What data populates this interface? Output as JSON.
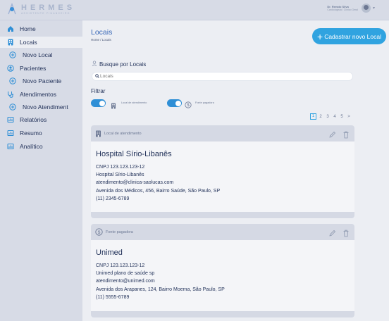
{
  "brand": {
    "title": "HERMES",
    "subtitle": "ASSISTENTE FINANCEIRO"
  },
  "user": {
    "name": "Dr. Renato Silva",
    "role": "Cardiologista / Clínico Geral"
  },
  "sidebar": {
    "items": [
      {
        "label": "Home",
        "icon": "home-icon",
        "active": false
      },
      {
        "label": "Locais",
        "icon": "building-icon",
        "active": true
      },
      {
        "label": "Novo Local",
        "icon": "plus-circle-icon",
        "active": false
      },
      {
        "label": "Pacientes",
        "icon": "user-circle-icon",
        "active": false
      },
      {
        "label": "Novo Paciente",
        "icon": "plus-circle-icon",
        "active": false
      },
      {
        "label": "Atendimentos",
        "icon": "stethoscope-icon",
        "active": false
      },
      {
        "label": "Novo Atendimento",
        "icon": "plus-circle-icon",
        "active": false
      },
      {
        "label": "Relatórios",
        "icon": "report-icon",
        "active": false
      },
      {
        "label": "Resumo",
        "icon": "report-icon",
        "active": false
      },
      {
        "label": "Analítico",
        "icon": "report-icon",
        "active": false
      }
    ]
  },
  "page": {
    "title": "Locais",
    "breadcrumb": "Home / Locais",
    "add_button": "Cadastrar novo Local"
  },
  "search": {
    "title": "Busque por Locais",
    "placeholder": "Locais"
  },
  "filter": {
    "label": "Filtrar",
    "options": [
      {
        "label": "Local de atendimento",
        "checked": true,
        "icon": "building-icon"
      },
      {
        "label": "Fonte pagadora",
        "checked": true,
        "icon": "dollar-circle-icon"
      }
    ]
  },
  "pagination": {
    "current": "1",
    "pages": [
      "1",
      "2",
      "3",
      "4",
      "5"
    ],
    "next": ">"
  },
  "cards": [
    {
      "type": "Local de atendimento",
      "type_icon": "building-icon",
      "name": "Hospital Sírio-Libanês",
      "lines": [
        "CNPJ 123.123.123-12",
        "Hospital Sírio-Libanês",
        "atendimento@clinica-saolucas.com",
        "Avenida dos Médicos, 456, Bairro Saúde, São Paulo, SP",
        "(11) 2345-6789"
      ]
    },
    {
      "type": "Fonte pagadora",
      "type_icon": "dollar-circle-icon",
      "name": "Unimed",
      "lines": [
        "CNPJ 123.123.123-12",
        "Unimed plano de saúde sp",
        "atendimento@unimed.com",
        "Avenida dos Arapanes, 124, Bairro Moema, São Paulo, SP",
        "(11) 5555-6789"
      ]
    }
  ],
  "colors": {
    "accent": "#30a3e0",
    "title": "#3a69b8",
    "sidebar": "#d7dbe6",
    "text": "#1f2f57"
  }
}
